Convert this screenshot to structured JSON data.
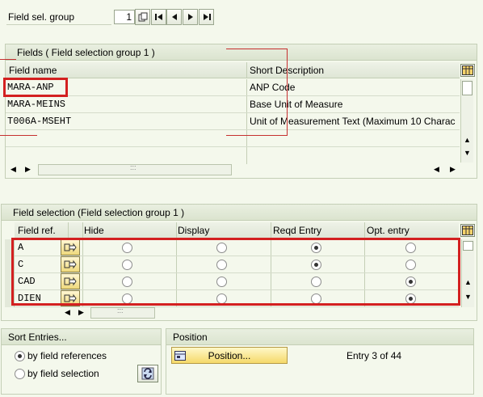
{
  "top": {
    "label": "Field sel. group",
    "value": "1",
    "nav_icons": [
      "copy-icon",
      "first-page-icon",
      "previous-page-icon",
      "next-page-icon",
      "last-page-icon"
    ]
  },
  "fields_panel": {
    "title": "Fields  ( Field selection group   1 )",
    "columns": [
      "Field name",
      "Short Description"
    ],
    "rows": [
      {
        "name": "MARA-ANP",
        "desc": "ANP Code"
      },
      {
        "name": "MARA-MEINS",
        "desc": "Base Unit of Measure"
      },
      {
        "name": "T006A-MSEHT",
        "desc": "Unit of Measurement Text (Maximum 10 Charac"
      }
    ]
  },
  "selection_panel": {
    "title": "Field selection (Field selection group   1 )",
    "columns": [
      "Field ref.",
      "Hide",
      "Display",
      "Reqd Entry",
      "Opt. entry"
    ],
    "rows": [
      {
        "ref": "A",
        "selected": "Reqd Entry"
      },
      {
        "ref": "C",
        "selected": "Reqd Entry"
      },
      {
        "ref": "CAD",
        "selected": "Opt. entry"
      },
      {
        "ref": "DIEN",
        "selected": "Opt. entry"
      }
    ]
  },
  "sort_panel": {
    "title": "Sort Entries...",
    "options": [
      "by field references",
      "by field selection"
    ],
    "selected": "by field references"
  },
  "position_panel": {
    "title": "Position",
    "button_label": "Position...",
    "entry_text": "Entry 3 of 44"
  },
  "colors": {
    "highlight": "#d32020",
    "background": "#f4f8ec"
  }
}
